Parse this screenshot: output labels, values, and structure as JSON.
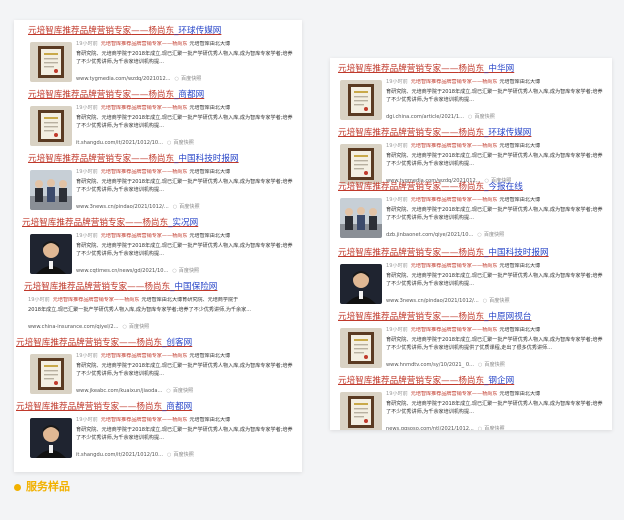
{
  "colors": {
    "accent": "#c0392b",
    "media": "#2a47c8",
    "label_gold": "#f2b100"
  },
  "footer": {
    "label": "服务样品"
  },
  "left": [
    {
      "title": "元培智库推荐品牌营销专家",
      "sep": "——",
      "name": "杨尚东",
      "media": "_环球传媒网",
      "time": "19小时前",
      "kw": "元培智库推荐品牌营销专家——杨尚东",
      "meta_tail": "元培智库由北大博",
      "snippet": "育研究院、元培商学院于2018年成立,现已汇聚一批产学研优秀人物入库,成为智库专家学者;培养了不少优秀讲师,为千余家培训机构提...",
      "url": "www.tygmedia.com/wzdq/2021012...",
      "thumb": "cert-frame-icon"
    },
    {
      "title": "元培智库推荐品牌营销专家",
      "sep": "——",
      "name": "杨尚东",
      "media": "_商都网",
      "time": "19小时前",
      "kw": "元培智库推荐品牌营销专家——杨尚东",
      "meta_tail": "元培智库由北大博",
      "snippet": "育研究院、元培商学院于2018年成立,现已汇聚一批产学研优秀人物入库,成为智库专家学者;培养了不少优秀讲师,为千余家培训机构提...",
      "url": "it.shangdu.com/it/2021/1012/10...",
      "thumb": "cert-frame-icon"
    },
    {
      "title": "元培智库推荐品牌营销专家",
      "sep": "——",
      "name": "杨尚东",
      "media": "_中国科技时报网",
      "time": "19小时前",
      "kw": "元培智库推荐品牌营销专家——杨尚东",
      "meta_tail": "元培智库由北大博",
      "snippet": "育研究院、元培商学院于2018年成立,现已汇聚一批产学研优秀人物入库,成为智库专家学者;培养了不少优秀讲师,为千余家培训机构提...",
      "url": "www.3news.cn/pindao/2021/1012/...",
      "thumb": "group-photo-icon"
    },
    {
      "title": "元培智库推荐品牌营销专家",
      "sep": "——",
      "name": "杨尚东",
      "media": "_实况网",
      "time": "19小时前",
      "kw": "元培智库推荐品牌营销专家——杨尚东",
      "meta_tail": "元培智库由北大博",
      "snippet": "育研究院、元培商学院于2018年成立,现已汇聚一批产学研优秀人物入库,成为智库专家学者;培养了不少优秀讲师,为千余家培训机构提...",
      "url": "www.cqtimes.cn/news/gd/2021/10...",
      "thumb": "portrait-icon"
    },
    {
      "title": "元培智库推荐品牌营销专家",
      "sep": "——",
      "name": "杨尚东",
      "media": "_中国保险网",
      "time": "19小时前",
      "kw": "元培智库推荐品牌营销专家——杨尚东",
      "meta_tail": "元培智库由北大博育研究院、元培商学院于",
      "snippet": "2018年成立,现已汇聚一批产学研优秀人物入库,成为智库专家学者;培养了不少优秀讲师,为千余家...",
      "url": "www.china-insurance.com/qiyel/2...",
      "thumb": ""
    },
    {
      "title": "元培智库推荐品牌营销专家",
      "sep": "——",
      "name": "杨尚东",
      "media": "_创客网",
      "time": "19小时前",
      "kw": "元培智库推荐品牌营销专家——杨尚东",
      "meta_tail": "元培智库由北大博",
      "snippet": "育研究院、元培商学院于2018年成立,现已汇聚一批产学研优秀人物入库,成为智库专家学者;培养了不少优秀讲师,为千余家培训机构提...",
      "url": "www.jkeabc.com/kuaixun/jiaoda...",
      "thumb": "cert-frame-icon"
    },
    {
      "title": "元培智库推荐品牌营销专家",
      "sep": "——",
      "name": "杨尚东",
      "media": "_商都网",
      "time": "19小时前",
      "kw": "元培智库推荐品牌营销专家——杨尚东",
      "meta_tail": "元培智库由北大博",
      "snippet": "育研究院、元培商学院于2018年成立,现已汇聚一批产学研优秀人物入库,成为智库专家学者;培养了不少优秀讲师,为千余家培训机构提...",
      "url": "it.shangdu.com/it/2021/1012/10...",
      "thumb": "portrait-icon"
    }
  ],
  "right": [
    {
      "title": "元培智库推荐品牌营销专家",
      "sep": "——",
      "name": "杨尚东",
      "media": "_中华网",
      "time": "19小时前",
      "kw": "元培智库推荐品牌营销专家——杨尚东",
      "meta_tail": "元培智库由北大博",
      "snippet": "育研究院、元培商学院于2018年成立,现已汇聚一批产学研优秀人物入库,成为智库专家学者;培养了不少优秀讲师,为千余家培训机构提...",
      "url": "dgi.china.com/article/2021/1...",
      "thumb": "cert-frame-icon"
    },
    {
      "title": "元培智库推荐品牌营销专家",
      "sep": "——",
      "name": "杨尚东",
      "media": "_环球传媒网",
      "time": "19小时前",
      "kw": "元培智库推荐品牌营销专家——杨尚东",
      "meta_tail": "元培智库由北大博",
      "snippet": "育研究院、元培商学院于2018年成立,现已汇聚一批产学研优秀人物入库,成为智库专家学者;培养了不少优秀讲师,为千余家培训机构提...",
      "url": "www.tygmedia.com/wzdq/2021012...",
      "thumb": "cert-frame-icon"
    },
    {
      "title": "元培智库推荐品牌营销专家",
      "sep": "——",
      "name": "杨尚东",
      "media": "_今报在线",
      "time": "19小时前",
      "kw": "元培智库推荐品牌营销专家——杨尚东",
      "meta_tail": "元培智库由北大博",
      "snippet": "育研究院、元培商学院于2018年成立,现已汇聚一批产学研优秀人物入库,成为智库专家学者;培养了不少优秀讲师,为千余家培训机构提...",
      "url": "dzb.jinbaonet.com/qiye/2021/10...",
      "thumb": "group-photo-icon"
    },
    {
      "title": "元培智库推荐品牌营销专家",
      "sep": "——",
      "name": "杨尚东",
      "media": "_中国科技时报网",
      "time": "19小时前",
      "kw": "元培智库推荐品牌营销专家——杨尚东",
      "meta_tail": "元培智库由北大博",
      "snippet": "育研究院、元培商学院于2018年成立,现已汇聚一批产学研优秀人物入库,成为智库专家学者;培养了不少优秀讲师,为千余家培训机构提...",
      "url": "www.3news.cn/pindao/2021/1012/...",
      "thumb": "portrait-icon"
    },
    {
      "title": "元培智库推荐品牌营销专家",
      "sep": "——",
      "name": "杨尚东",
      "media": "_中原网视台",
      "time": "19小时前",
      "kw": "元培智库推荐品牌营销专家——杨尚东",
      "meta_tail": "元培智库由北大博",
      "snippet": "育研究院、元培商学院于2018年成立,现已汇聚一批产学研优秀人物入库,成为智库专家学者;培养了不少优秀讲师,为千余家培训机构提供了优质课程,走出了很多优秀讲师...",
      "url": "www.hnmdtv.com/sy/10/2021_ 0...",
      "thumb": "cert-frame-icon"
    },
    {
      "title": "元培智库推荐品牌营销专家",
      "sep": "——",
      "name": "杨尚东",
      "media": "_钢企网",
      "time": "19小时前",
      "kw": "元培智库推荐品牌营销专家——杨尚东",
      "meta_tail": "元培智库由北大博",
      "snippet": "育研究院、元培商学院于2018年成立,现已汇聚一批产学研优秀人物入库,成为智库专家学者;培养了不少优秀讲师,为千余家培训机构提...",
      "url": "news.gqsoso.com/ntl/2021/1012...",
      "thumb": "cert-frame-icon"
    }
  ],
  "snapshot_label": "百度快照"
}
